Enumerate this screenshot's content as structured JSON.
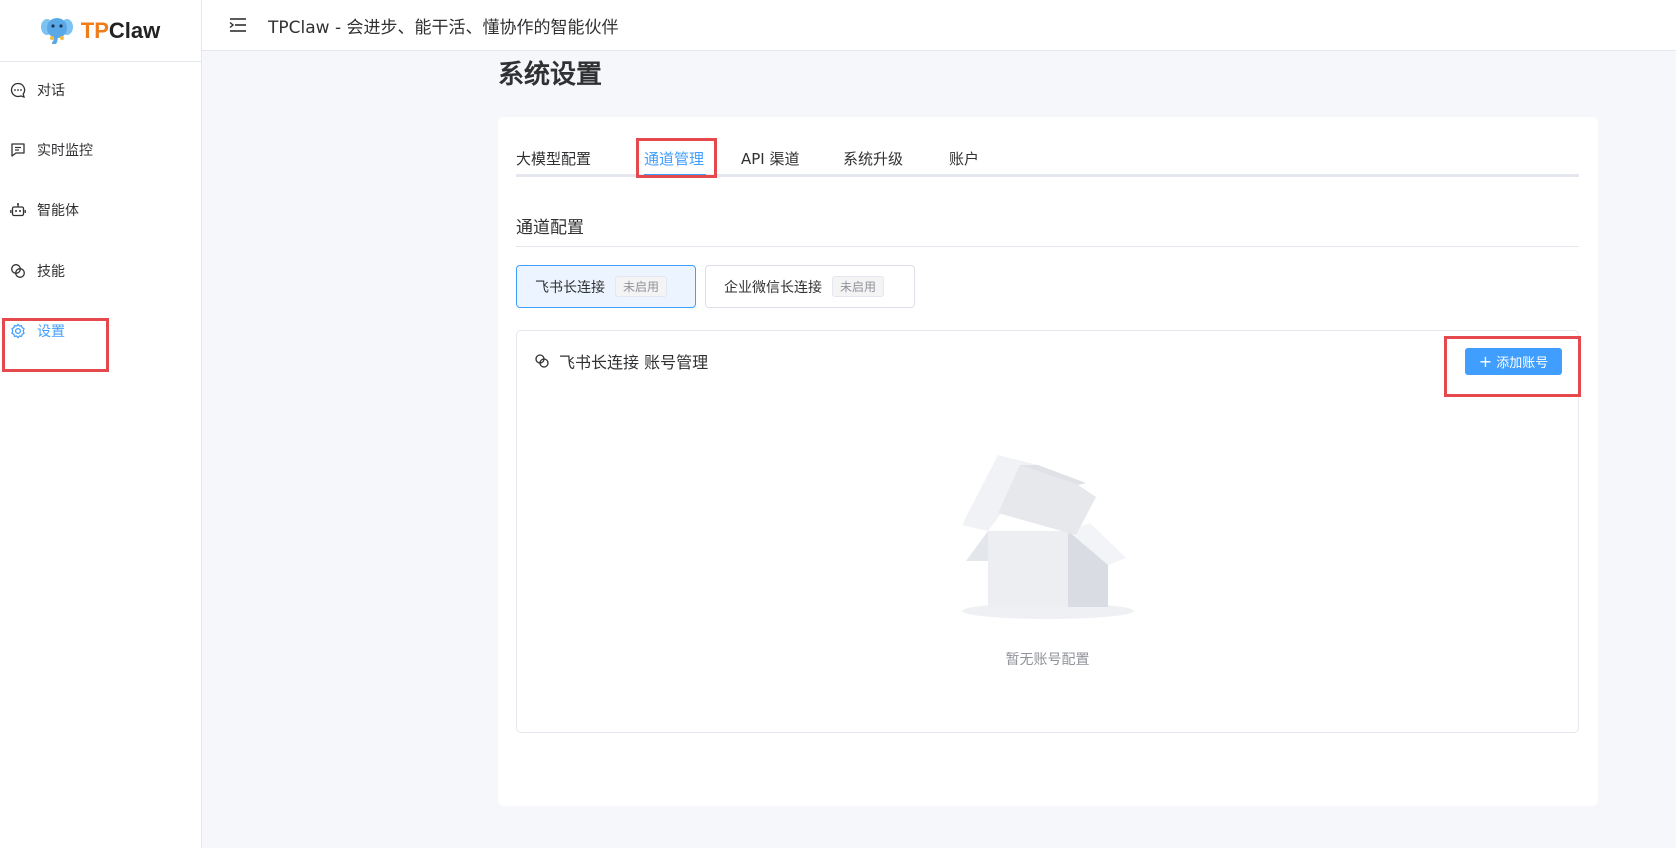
{
  "app": {
    "logo_tp": "TP",
    "logo_claw": "Claw",
    "header_title": "TPClaw - 会进步、能干活、懂协作的智能伙伴"
  },
  "sidebar": {
    "items": [
      {
        "label": "对话",
        "icon": "chat-icon"
      },
      {
        "label": "实时监控",
        "icon": "monitor-icon"
      },
      {
        "label": "智能体",
        "icon": "robot-icon"
      },
      {
        "label": "技能",
        "icon": "skill-icon"
      },
      {
        "label": "设置",
        "icon": "gear-icon",
        "active": true
      }
    ]
  },
  "page": {
    "title": "系统设置",
    "tabs": [
      {
        "label": "大模型配置"
      },
      {
        "label": "通道管理",
        "active": true
      },
      {
        "label": "API 渠道"
      },
      {
        "label": "系统升级"
      },
      {
        "label": "账户"
      }
    ],
    "section_title": "通道配置",
    "channels": [
      {
        "label": "飞书长连接",
        "status": "未启用",
        "active": true
      },
      {
        "label": "企业微信长连接",
        "status": "未启用"
      }
    ],
    "account_panel": {
      "title": "飞书长连接 账号管理",
      "add_button": "添加账号",
      "empty_text": "暂无账号配置"
    }
  },
  "colors": {
    "accent": "#409eff",
    "highlight": "#e5484d",
    "logo_orange": "#f07c1a"
  }
}
